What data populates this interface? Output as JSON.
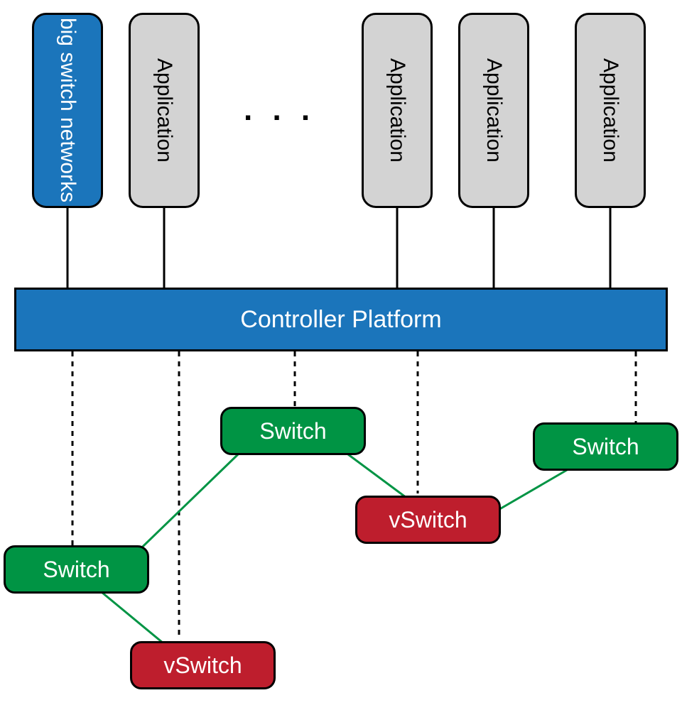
{
  "top": {
    "vendor": "big switch networks",
    "app_label": "Application",
    "ellipsis": ". . ."
  },
  "controller": "Controller Platform",
  "nodes": {
    "switch": "Switch",
    "vswitch": "vSwitch"
  }
}
